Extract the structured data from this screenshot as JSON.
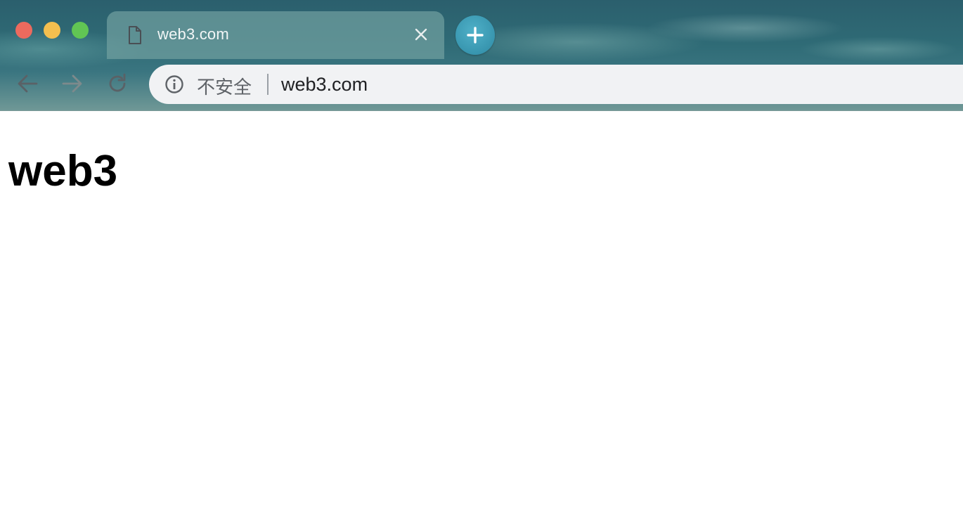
{
  "window": {
    "controls": [
      "close",
      "minimize",
      "maximize"
    ]
  },
  "tab": {
    "title": "web3.com",
    "icon": "document-icon"
  },
  "toolbar": {
    "back_icon": "arrow-left-icon",
    "forward_icon": "arrow-right-icon",
    "reload_icon": "reload-icon",
    "new_tab_icon": "plus-icon"
  },
  "omnibox": {
    "security_icon": "info-icon",
    "security_label": "不安全",
    "url": "web3.com"
  },
  "page": {
    "heading": "web3"
  },
  "colors": {
    "close": "#ec6a5e",
    "minimize": "#f4bf4f",
    "maximize": "#61c554",
    "new_tab": "#3a9cb6",
    "omnibox_bg": "#f1f2f4"
  }
}
